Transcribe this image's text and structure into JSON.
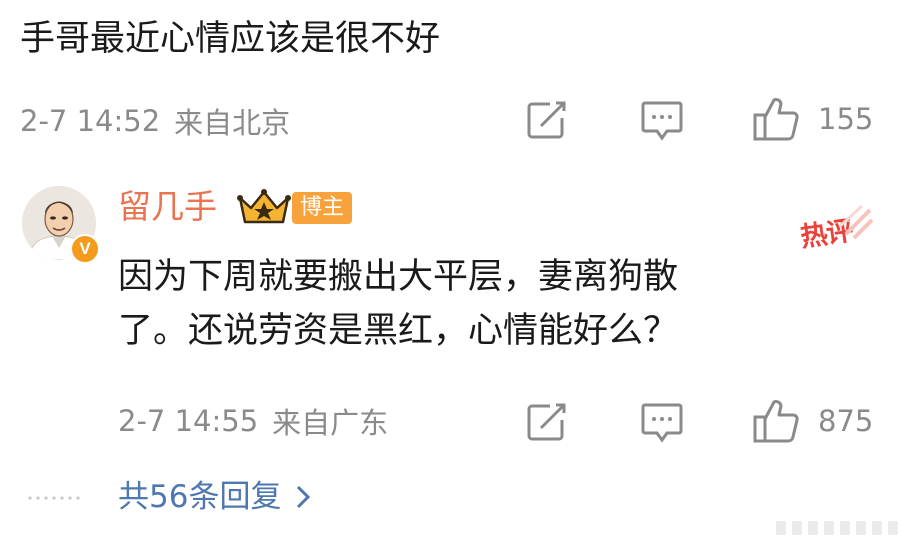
{
  "top_comment": {
    "text": "手哥最近心情应该是很不好",
    "time": "2-7 14:52",
    "location": "来自北京",
    "like_count": "155"
  },
  "reply": {
    "username": "留几手",
    "role_badge": "博主",
    "hot_badge": "热评",
    "text_line1": "因为下周就要搬出大平层，妻离狗散",
    "text_line2": "了。还说劳资是黑红，心情能好么？",
    "time": "2-7 14:55",
    "location": "来自广东",
    "like_count": "875"
  },
  "footer": {
    "more_replies": "共56条回复"
  },
  "icons": {
    "share": "share-icon",
    "comment": "comment-icon",
    "like": "thumbs-up-icon",
    "more": "chevron-right-icon",
    "crown": "crown-icon",
    "verified": "verified-v-icon"
  },
  "colors": {
    "username": "#eb7350",
    "link": "#4e77b0",
    "meta": "#8a8a8a",
    "badge": "#f7a23a",
    "hot": "#e8423a",
    "verified": "#f59b1c"
  }
}
